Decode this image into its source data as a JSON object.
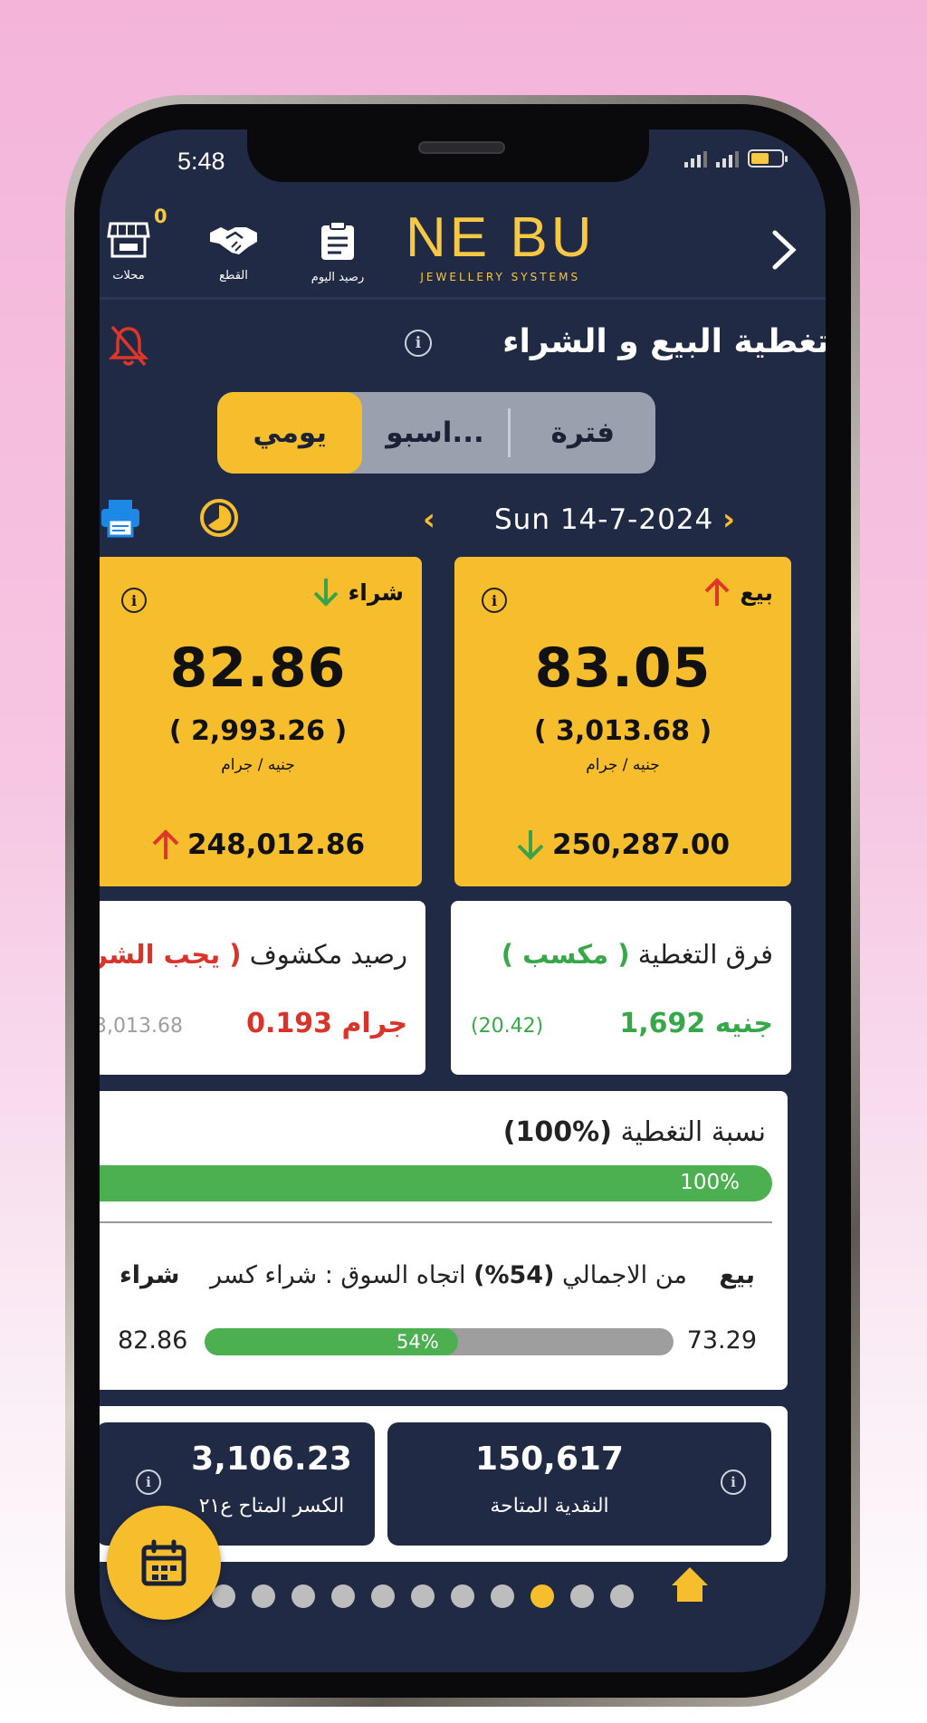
{
  "status": {
    "time": "5:48"
  },
  "header": {
    "badge_count": "0",
    "nav": [
      {
        "label": "محلات",
        "icon": "store-icon"
      },
      {
        "label": "القطع",
        "icon": "handshake-icon"
      },
      {
        "label": "رصيد اليوم",
        "icon": "clipboard-icon"
      }
    ],
    "logo_main": "NE BU",
    "logo_sub": "JEWELLERY SYSTEMS"
  },
  "page_title": "تغطية البيع و الشراء",
  "segments": {
    "period": "فترة",
    "weekly": "اسبو...",
    "daily": "يومي",
    "selected": "daily"
  },
  "date": {
    "text": "Sun  14-7-2024"
  },
  "sell_card": {
    "title": "بيع",
    "value": "83.05",
    "sub": "( 3,013.68 )",
    "unit": "جنيه / جرام",
    "total": "250,287.00"
  },
  "buy_card": {
    "title": "شراء",
    "value": "82.86",
    "sub": "( 2,993.26 )",
    "unit": "جنيه / جرام",
    "total": "248,012.86"
  },
  "coverage_diff": {
    "label": "فرق التغطية",
    "tag": "( مكسب )",
    "value": "1,692 جنيه",
    "secondary": "(20.42)"
  },
  "uncovered_balance": {
    "label": "رصيد مكشوف",
    "tag": "( يجب الشراء )",
    "value": "0.193 جرام",
    "secondary": "3,013.68"
  },
  "coverage_ratio": {
    "label": "نسبة التغطية",
    "value": "(100%)",
    "bar_text": "100%",
    "bar_fraction": 1.0
  },
  "market": {
    "sell_label": "بيع",
    "direction": "اتجاه السوق : شراء كسر",
    "pct": "(54%)",
    "of_total": "من الاجمالي",
    "buy_label": "شراء",
    "left_value": "82.86",
    "right_value": "73.29",
    "bar_text": "54%",
    "bar_fraction": 0.54
  },
  "available_cash": {
    "value": "150,617",
    "label": "النقدية المتاحة"
  },
  "available_scrap": {
    "value": "3,106.23",
    "label": "الكسر المتاح ع٢١"
  },
  "pager": {
    "count": 12,
    "active_index": 9
  },
  "colors": {
    "navy": "#212a45",
    "gold": "#f6be2c",
    "green": "#4caf50",
    "red": "#d8342a"
  }
}
